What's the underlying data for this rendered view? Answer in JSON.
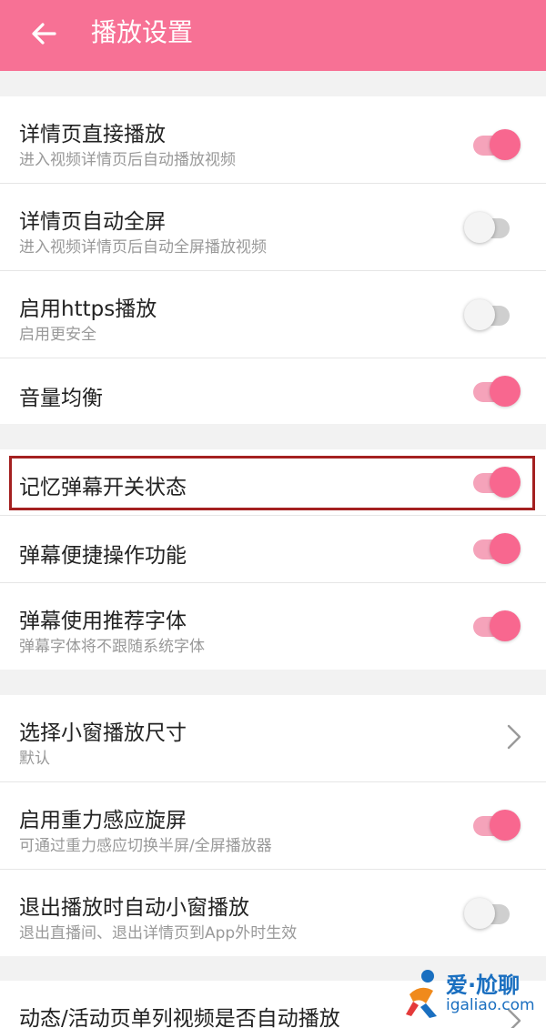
{
  "header": {
    "title": "播放设置",
    "back_icon": "arrow-left-icon",
    "color": "#f77195"
  },
  "settings": [
    {
      "label": "详情页直接播放",
      "sub": "进入视频详情页后自动播放视频",
      "control": "toggle",
      "on": true
    },
    {
      "label": "详情页自动全屏",
      "sub": "进入视频详情页后自动全屏播放视频",
      "control": "toggle",
      "on": false
    },
    {
      "label": "启用https播放",
      "sub": "启用更安全",
      "control": "toggle",
      "on": false
    },
    {
      "label": "音量均衡",
      "sub": "",
      "control": "toggle",
      "on": true
    },
    {
      "label": "记忆弹幕开关状态",
      "sub": "",
      "control": "toggle",
      "on": true
    },
    {
      "label": "弹幕便捷操作功能",
      "sub": "",
      "control": "toggle",
      "on": true
    },
    {
      "label": "弹幕使用推荐字体",
      "sub": "弹幕字体将不跟随系统字体",
      "control": "toggle",
      "on": true
    },
    {
      "label": "选择小窗播放尺寸",
      "sub": "默认",
      "control": "chevron"
    },
    {
      "label": "启用重力感应旋屏",
      "sub": "可通过重力感应切换半屏/全屏播放器",
      "control": "toggle",
      "on": true
    },
    {
      "label": "退出播放时自动小窗播放",
      "sub": "退出直播间、退出详情页到App外时生效",
      "control": "toggle",
      "on": false
    },
    {
      "label": "动态/活动页单列视频是否自动播放",
      "sub": "",
      "control": "chevron"
    }
  ],
  "colors": {
    "accent": "#f8678f",
    "highlight_border": "#a42020"
  },
  "watermark": {
    "line1": "爱·尬聊",
    "line2": "igaliao.com",
    "icon": "runner-logo-icon"
  }
}
